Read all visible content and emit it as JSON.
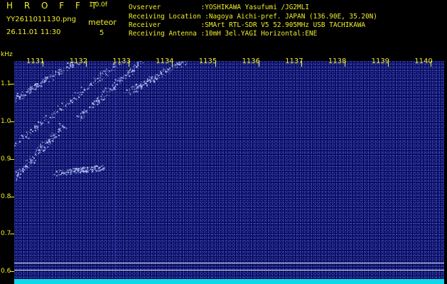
{
  "app": {
    "name": "H R O F F T",
    "version": "1.0.0f"
  },
  "file": {
    "name": "YY2611011130.png",
    "timestamp": "26.11.01 11:30"
  },
  "observation": {
    "category": "meteor",
    "count": "5"
  },
  "info": [
    "Ovserver          :YOSHIKAWA Yasufumi /JG2MLI",
    "Receiving Location :Nagoya Aichi-pref. JAPAN (136.90E, 35.20N)",
    "Receiver          :SMArt RTL-SDR V5 52.905MHz USB TACHIKAWA",
    "Receiving Antenna :10mH 3el.YAGI Horizontal:ENE"
  ],
  "chart_data": {
    "type": "heatmap",
    "ylabel": "kHz",
    "yticks": [
      "1.1",
      "1.0",
      "0.9",
      "0.8",
      "0.7",
      "0.6"
    ],
    "xticks": [
      "1131",
      "1132",
      "1133",
      "1134",
      "1135",
      "1136",
      "1137",
      "1138",
      "1139",
      "1140"
    ],
    "ylim": [
      0.58,
      1.16
    ],
    "colors": {
      "background": "#03034d",
      "signal": "#b8ccff",
      "baseline": "#0fd6e8",
      "text": "#f2ee2a"
    }
  }
}
